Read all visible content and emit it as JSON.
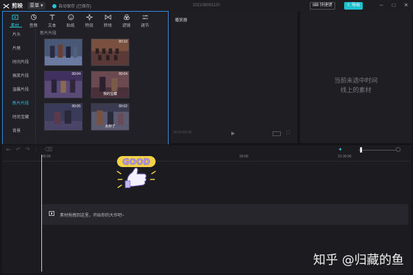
{
  "app": {
    "name": "剪映"
  },
  "topbar": {
    "menu_label": "菜单",
    "autosave_text": "自动保存 (已保存)",
    "project_title": "202108081120",
    "shortcut_label": "快捷键",
    "export_label": "导出"
  },
  "media": {
    "tabs": [
      {
        "label": "素材",
        "icon": "media-icon"
      },
      {
        "label": "音频",
        "icon": "music-icon"
      },
      {
        "label": "文本",
        "icon": "text-icon"
      },
      {
        "label": "贴纸",
        "icon": "sticker-icon"
      },
      {
        "label": "特效",
        "icon": "effects-icon"
      },
      {
        "label": "转场",
        "icon": "transition-icon"
      },
      {
        "label": "滤镜",
        "icon": "filter-icon"
      },
      {
        "label": "调节",
        "icon": "adjust-icon"
      }
    ],
    "sidebar": [
      "片头",
      "片尾",
      "时间片段",
      "搞笑片段",
      "温馨片段",
      "新片片段",
      "时尚宝藏",
      "背景"
    ],
    "active_sidebar_index": 5,
    "section_title": "新片片段",
    "thumbs": [
      {
        "duration": "",
        "caption": ""
      },
      {
        "duration": "00:10",
        "caption": ""
      },
      {
        "duration": "00:04",
        "caption": ""
      },
      {
        "duration": "00:04",
        "caption": "我的宝藏"
      },
      {
        "duration": "00:05",
        "caption": ""
      },
      {
        "duration": "00:02",
        "caption": "太好了"
      }
    ]
  },
  "player": {
    "title": "播放器",
    "time": "00:00:00:00"
  },
  "properties": {
    "empty_line1": "当前未选中时间",
    "empty_line2": "线上的素材"
  },
  "timeline": {
    "ruler_ticks": [
      "00:00",
      "00:00",
      "01:30:00"
    ],
    "track_hint": "素材拖拽到这里，开始你的大作吧~"
  },
  "watermark": "知乎 @归藏的鱼",
  "colors": {
    "accent": "#25c2d2",
    "selection": "#2f8de6",
    "background": "#16161a"
  }
}
